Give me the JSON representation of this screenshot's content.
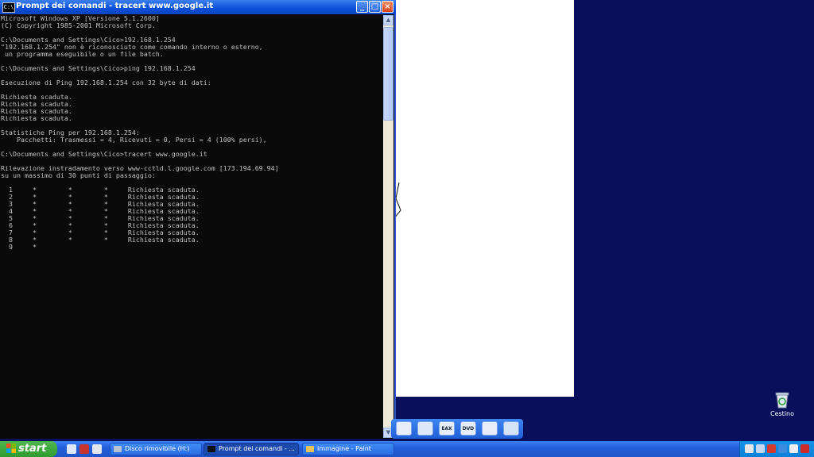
{
  "cmd_window": {
    "title": "Prompt dei comandi - tracert www.google.it",
    "title_icon": "cmd-icon",
    "buttons": {
      "minimize": "minimize-icon",
      "maximize": "maximize-icon",
      "close": "close-icon"
    },
    "lines": [
      "Microsoft Windows XP [Versione 5.1.2600]",
      "(C) Copyright 1985-2001 Microsoft Corp.",
      "",
      "C:\\Documents and Settings\\Cico>192.168.1.254",
      "\"192.168.1.254\" non è riconosciuto come comando interno o esterno,",
      " un programma eseguibile o un file batch.",
      "",
      "C:\\Documents and Settings\\Cico>ping 192.168.1.254",
      "",
      "Esecuzione di Ping 192.168.1.254 con 32 byte di dati:",
      "",
      "Richiesta scaduta.",
      "Richiesta scaduta.",
      "Richiesta scaduta.",
      "Richiesta scaduta.",
      "",
      "Statistiche Ping per 192.168.1.254:",
      "    Pacchetti: Trasmessi = 4, Ricevuti = 0, Persi = 4 (100% persi),",
      "",
      "C:\\Documents and Settings\\Cico>tracert www.google.it",
      "",
      "Rilevazione instradamento verso www-cctld.l.google.com [173.194.69.94]",
      "su un massimo di 30 punti di passaggio:",
      "",
      "  1     *        *        *     Richiesta scaduta.",
      "  2     *        *        *     Richiesta scaduta.",
      "  3     *        *        *     Richiesta scaduta.",
      "  4     *        *        *     Richiesta scaduta.",
      "  5     *        *        *     Richiesta scaduta.",
      "  6     *        *        *     Richiesta scaduta.",
      "  7     *        *        *     Richiesta scaduta.",
      "  8     *        *        *     Richiesta scaduta.",
      "  9     *"
    ]
  },
  "desktop": {
    "recycle_bin_label": "Cestino",
    "recycle_bin_icon": "recycle-bin-icon"
  },
  "quick_launch_icons": [
    "wmp-icon",
    "media-icon",
    "eax-icon",
    "dvd-icon",
    "app-icon",
    "toolbar-icon"
  ],
  "quick_launch_labels": [
    "",
    "",
    "EAX",
    "DVD",
    "",
    ""
  ],
  "taskbar": {
    "start_label": "start",
    "tasks": [
      {
        "label": "Disco rimovibile (H:)",
        "icon": "drive-icon",
        "active": false
      },
      {
        "label": "Prompt dei comandi - ...",
        "icon": "cmd-icon",
        "active": true
      },
      {
        "label": "Immagine - Paint",
        "icon": "paint-icon",
        "active": false
      }
    ],
    "tray_icons": [
      "network-icon",
      "volume-icon",
      "antivirus-icon",
      "security-icon",
      "update-icon",
      "shield-icon"
    ]
  },
  "colors": {
    "console_bg": "#0a0a0a",
    "console_text": "#c0c0c0",
    "desktop_bg": "#0a0f5c",
    "taskbar_blue": "#245edb",
    "start_green": "#3a9e3a"
  }
}
